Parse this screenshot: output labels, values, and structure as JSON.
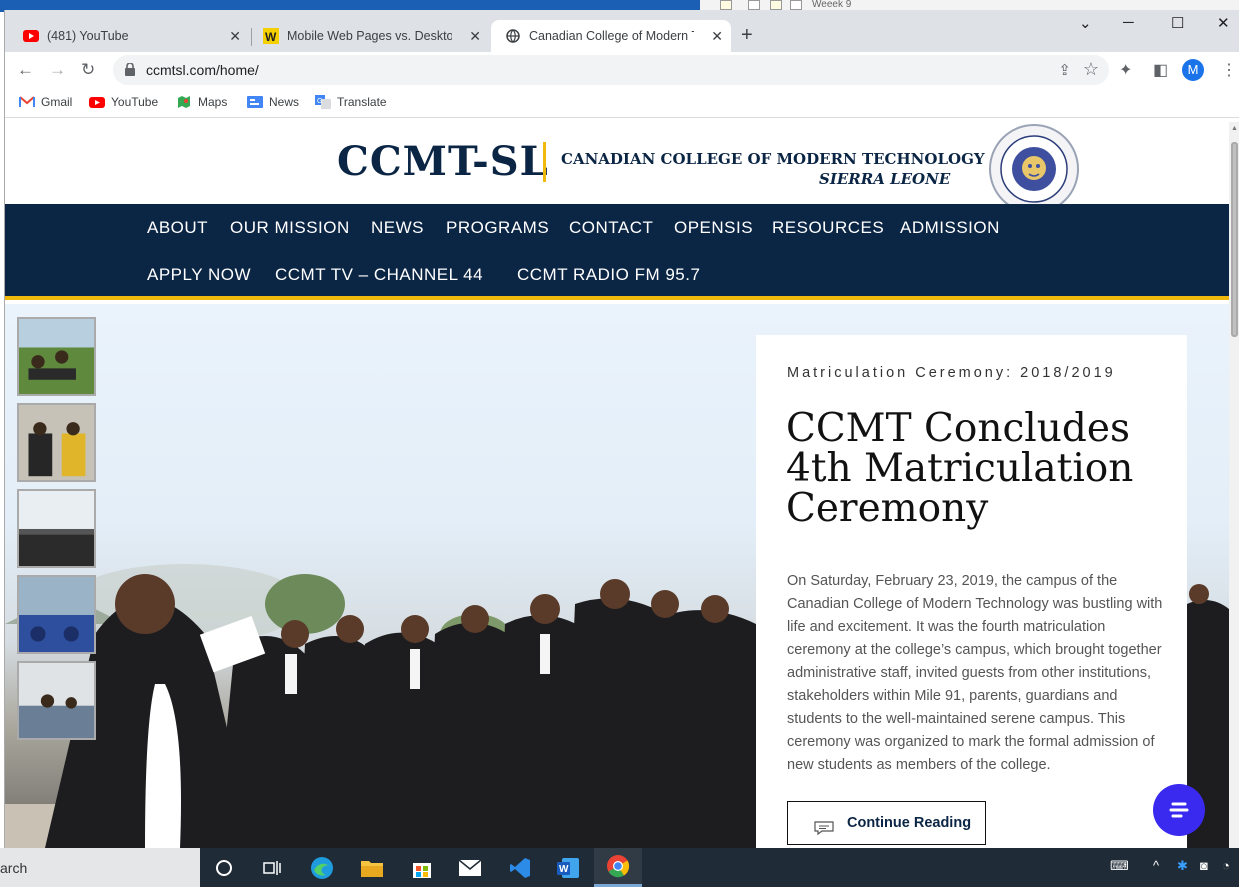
{
  "background_app": {
    "text": "Weeek 9"
  },
  "browser": {
    "tabs": [
      {
        "title": "(481) YouTube",
        "favicon": "youtube-icon"
      },
      {
        "title": "Mobile Web Pages vs. Desktop W",
        "favicon": "w-logo-icon"
      },
      {
        "title": "Canadian College of Modern Tec",
        "favicon": "globe-icon",
        "active": true
      }
    ],
    "url": "ccmtsl.com/home/",
    "avatar_letter": "M",
    "bookmarks": [
      {
        "label": "Gmail",
        "icon": "gmail-icon"
      },
      {
        "label": "YouTube",
        "icon": "youtube-icon"
      },
      {
        "label": "Maps",
        "icon": "maps-icon"
      },
      {
        "label": "News",
        "icon": "news-icon"
      },
      {
        "label": "Translate",
        "icon": "translate-icon"
      }
    ]
  },
  "site": {
    "logo": {
      "main": "CCMT-SL",
      "line1": "CANADIAN COLLEGE OF MODERN TECHNOLOGY",
      "line2": "SIERRA LEONE"
    },
    "nav_row1": [
      "ABOUT",
      "OUR MISSION",
      "NEWS",
      "PROGRAMS",
      "CONTACT",
      "OPENSIS",
      "RESOURCES",
      "ADMISSION"
    ],
    "nav_row2": [
      "APPLY NOW",
      "CCMT TV – CHANNEL 44",
      "CCMT RADIO FM 95.7"
    ],
    "article": {
      "kicker": "Matriculation Ceremony: 2018/2019",
      "title": "CCMT Concludes 4th Matriculation Ceremony",
      "body": "On Saturday, February 23, 2019, the campus of the Canadian College of Modern Technology was bustling with life and excitement. It was the fourth matriculation ceremony at the college’s campus, which brought together administrative staff, invited guests from other institutions, stakeholders within Mile 91, parents, guardians and students to the well-maintained serene campus. This ceremony was organized to mark the formal admission of new students as members of the college.",
      "cta": "Continue Reading"
    },
    "colors": {
      "navy": "#0b2545",
      "gold": "#f0b90b",
      "chat": "#3a2af0"
    }
  },
  "taskbar": {
    "search_text": "arch"
  }
}
